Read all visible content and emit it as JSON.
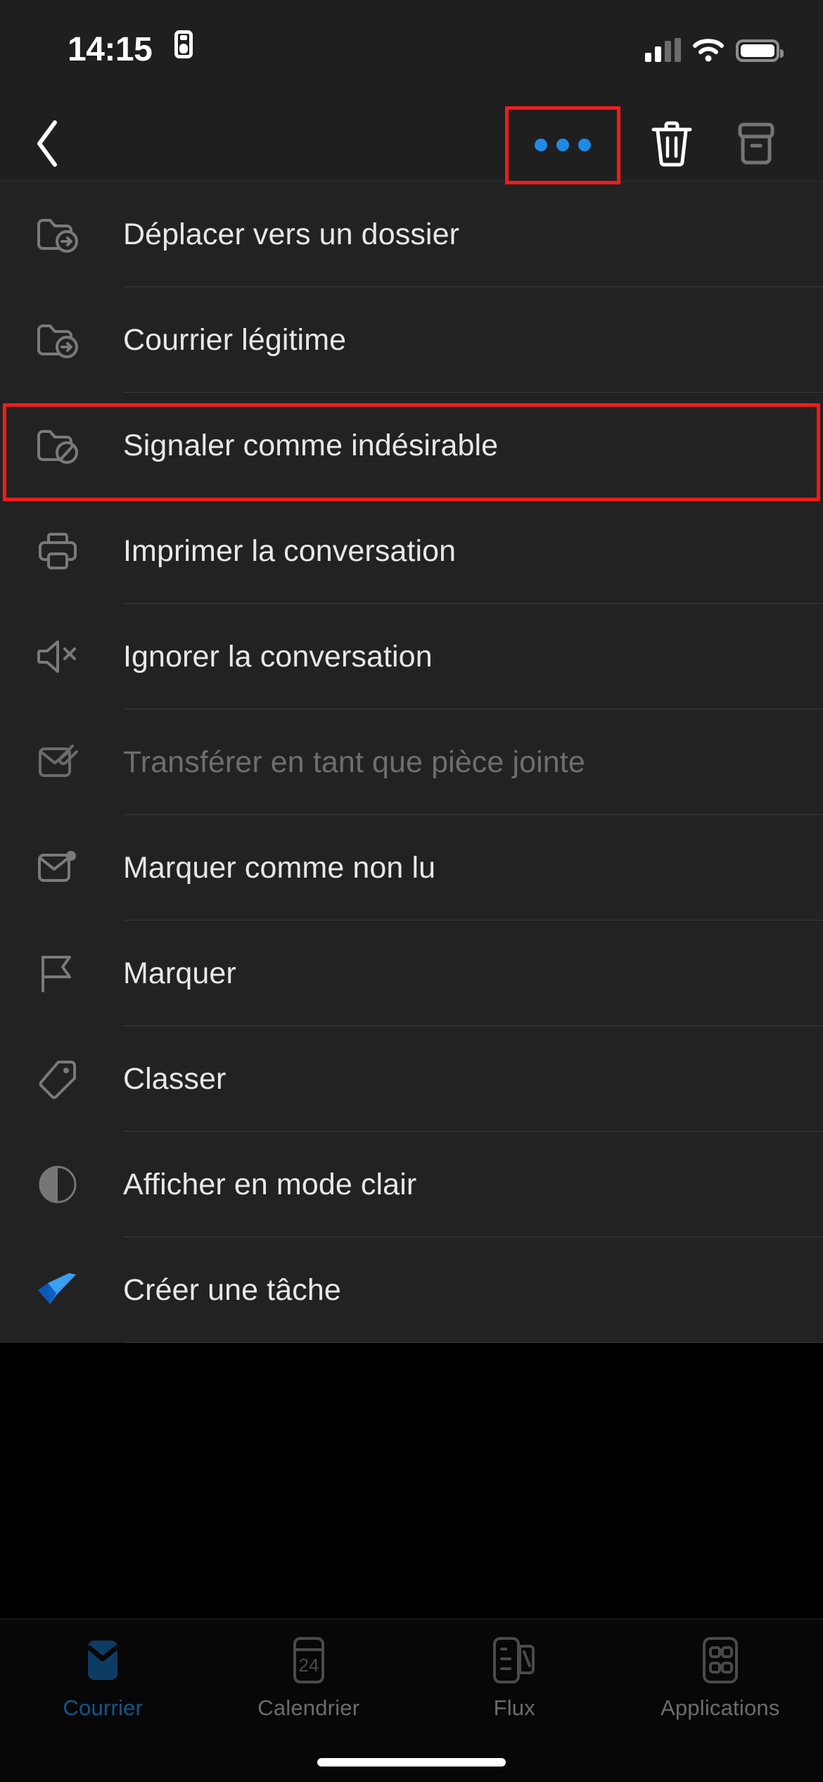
{
  "status_bar": {
    "time": "14:15",
    "badge_icon": "id-badge-icon",
    "signal_icon": "cellular-signal-icon",
    "wifi_icon": "wifi-icon",
    "battery_icon": "battery-full-icon"
  },
  "toolbar": {
    "back_icon": "chevron-left-icon",
    "more_icon": "more-options-icon",
    "delete_icon": "trash-icon",
    "archive_icon": "archive-box-icon",
    "highlight_color": "#f41b1b",
    "accent_color": "#1e8ae6"
  },
  "menu": {
    "items": [
      {
        "label": "Déplacer vers un dossier",
        "icon": "folder-move-icon",
        "disabled": false,
        "highlighted": false
      },
      {
        "label": "Courrier légitime",
        "icon": "folder-move-icon",
        "disabled": false,
        "highlighted": false
      },
      {
        "label": "Signaler comme indésirable",
        "icon": "folder-block-icon",
        "disabled": false,
        "highlighted": true
      },
      {
        "label": "Imprimer la conversation",
        "icon": "printer-icon",
        "disabled": false,
        "highlighted": false
      },
      {
        "label": "Ignorer la conversation",
        "icon": "speaker-mute-icon",
        "disabled": false,
        "highlighted": false
      },
      {
        "label": "Transférer en tant que pièce jointe",
        "icon": "envelope-attachment-icon",
        "disabled": true,
        "highlighted": false
      },
      {
        "label": "Marquer comme non lu",
        "icon": "envelope-unread-icon",
        "disabled": false,
        "highlighted": false
      },
      {
        "label": "Marquer",
        "icon": "flag-icon",
        "disabled": false,
        "highlighted": false
      },
      {
        "label": "Classer",
        "icon": "tag-icon",
        "disabled": false,
        "highlighted": false
      },
      {
        "label": "Afficher en mode clair",
        "icon": "contrast-circle-icon",
        "disabled": false,
        "highlighted": false
      },
      {
        "label": "Créer une tâche",
        "icon": "todo-check-icon",
        "disabled": false,
        "highlighted": false
      }
    ]
  },
  "tabbar": {
    "tabs": [
      {
        "label": "Courrier",
        "icon": "mail-icon",
        "active": true
      },
      {
        "label": "Calendrier",
        "icon": "calendar-24-icon",
        "active": false
      },
      {
        "label": "Flux",
        "icon": "feed-icon",
        "active": false
      },
      {
        "label": "Applications",
        "icon": "apps-grid-icon",
        "active": false
      }
    ],
    "active_color": "#11568e",
    "inactive_color": "#6c6c6c"
  }
}
